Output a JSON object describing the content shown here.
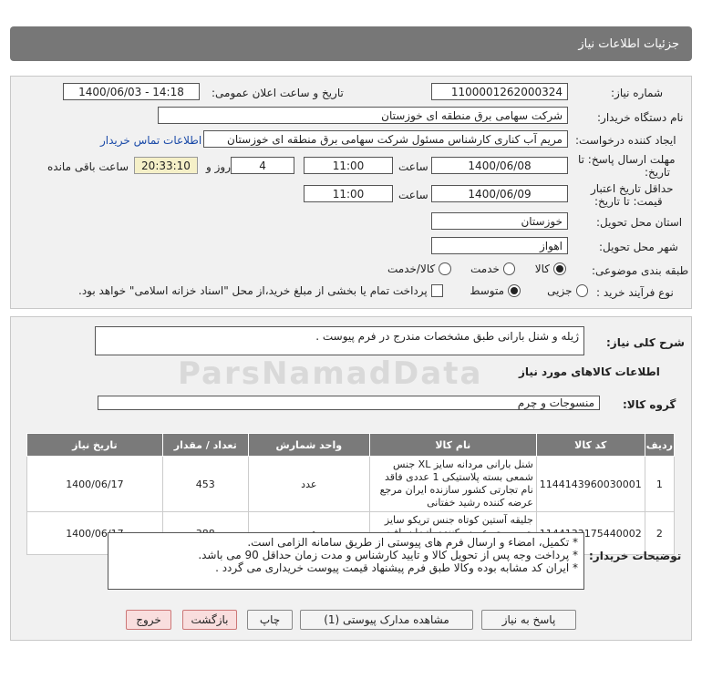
{
  "header": {
    "title": "جزئیات اطلاعات نیاز"
  },
  "form": {
    "need_number_label": "شماره نیاز:",
    "need_number": "1100001262000324",
    "announce_label": "تاریخ و ساعت اعلان عمومی:",
    "announce_value": "1400/06/03 - 14:18",
    "buyer_label": "نام دستگاه خریدار:",
    "buyer_value": "شرکت سهامی برق منطقه ای خوزستان",
    "creator_label": "ایجاد کننده درخواست:",
    "creator_value": "مریم آب کناری کارشناس مسئول شرکت سهامی برق منطقه ای خوزستان",
    "contact_link": "اطلاعات تماس خریدار",
    "deadline_label_1": "مهلت ارسال پاسخ: تا",
    "deadline_label_2": "تاریخ:",
    "deadline_date": "1400/06/08",
    "time_label": "ساعت",
    "deadline_time": "11:00",
    "days_value": "4",
    "days_label": "روز و",
    "remaining_time": "20:33:10",
    "remaining_label": "ساعت باقی مانده",
    "validity_label_1": "حداقل تاریخ اعتبار",
    "validity_label_2": "قیمت: تا تاریخ:",
    "validity_date": "1400/06/09",
    "validity_time_label": "ساعت",
    "validity_time": "11:00",
    "province_label": "استان محل تحویل:",
    "province_value": "خوزستان",
    "city_label": "شهر محل تحویل:",
    "city_value": "اهواز",
    "category_label": "طبقه بندی موضوعی:",
    "category_options": [
      "کالا",
      "خدمت",
      "کالا/خدمت"
    ],
    "process_label": "نوع فرآیند خرید :",
    "process_options": [
      "جزیی",
      "متوسط"
    ],
    "payment_note": "پرداخت تمام یا بخشی از مبلغ خرید،از محل \"اسناد خزانه اسلامی\" خواهد بود."
  },
  "description": {
    "label": "شرح کلی نیاز:",
    "value": "ژیله و شنل بارانی طبق مشخصات مندرج در فرم پیوست ."
  },
  "goods": {
    "section_title": "اطلاعات کالاهای مورد نیاز",
    "group_label": "گروه کالا:",
    "group_value": "منسوجات و چرم",
    "columns": [
      "ردیف",
      "کد کالا",
      "نام کالا",
      "واحد شمارش",
      "تعداد / مقدار",
      "تاریخ نیاز"
    ],
    "rows": [
      {
        "row": "1",
        "code": "1144143960030001",
        "name": "شنل بارانی مردانه سایز XL جنس شمعی بسته پلاستیکی 1 عددی فاقد نام تجارتی کشور سازنده ایران مرجع عرضه کننده رشید خفتانی",
        "unit": "عدد",
        "qty": "453",
        "date": "1400/06/17"
      },
      {
        "row": "2",
        "code": "1144133175440002",
        "name": "جلیقه آستین کوتاه جنس تریکو سایز جور مرجع عرضه کننده پاتیزان بافت مازندران",
        "unit": "عدد",
        "qty": "388",
        "date": "1400/06/17"
      }
    ]
  },
  "notes": {
    "label": "توضیحات خریدار:",
    "lines": [
      "* تکمیل، امضاء و ارسال فرم های پیوستی از طریق سامانه الزامی است.",
      "* پرداخت وجه پس از تحویل کالا و تایید کارشناس و مدت زمان حداقل 90  می باشد.",
      "* ایران کد مشابه بوده وکالا طبق فرم پیشنهاد قیمت پیوست خریداری می گردد ."
    ]
  },
  "buttons": {
    "reply": "پاسخ به نیاز",
    "attachments": "مشاهده مدارک پیوستی (1)",
    "print": "چاپ",
    "back": "بازگشت",
    "exit": "خروج"
  }
}
